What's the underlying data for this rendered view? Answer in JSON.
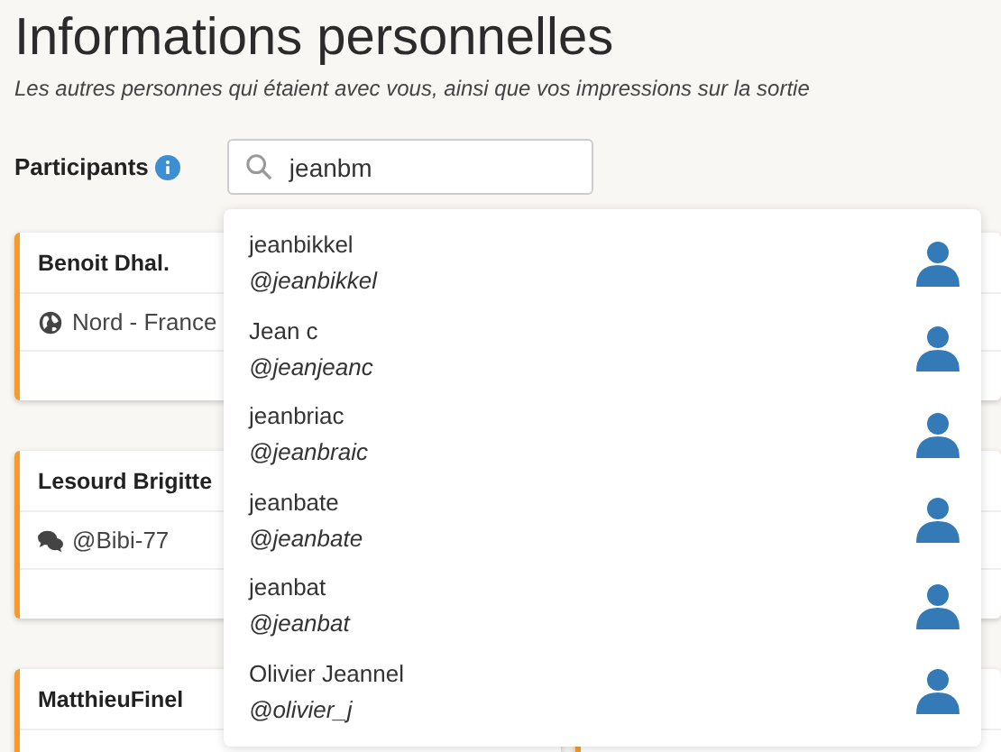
{
  "title": "Informations personnelles",
  "subtitle": "Les autres personnes qui étaient avec vous, ainsi que vos impressions sur la sortie",
  "participants": {
    "label": "Participants",
    "search_value": "jeanbm"
  },
  "cards": [
    {
      "name": "Benoit Dhal.",
      "kind": "location",
      "detail": "Nord - France"
    },
    {
      "name": "Lesourd Brigitte",
      "kind": "handle",
      "detail": "@Bibi-77"
    },
    {
      "name": "MatthieuFinel",
      "kind": "none"
    }
  ],
  "suggestions": [
    {
      "name": "jeanbikkel",
      "handle": "@jeanbikkel"
    },
    {
      "name": "Jean c",
      "handle": "@jeanjeanc"
    },
    {
      "name": "jeanbriac",
      "handle": "@jeanbraic"
    },
    {
      "name": "jeanbate",
      "handle": "@jeanbate"
    },
    {
      "name": "jeanbat",
      "handle": "@jeanbat"
    },
    {
      "name": "Olivier Jeannel",
      "handle": "@olivier_j"
    }
  ]
}
